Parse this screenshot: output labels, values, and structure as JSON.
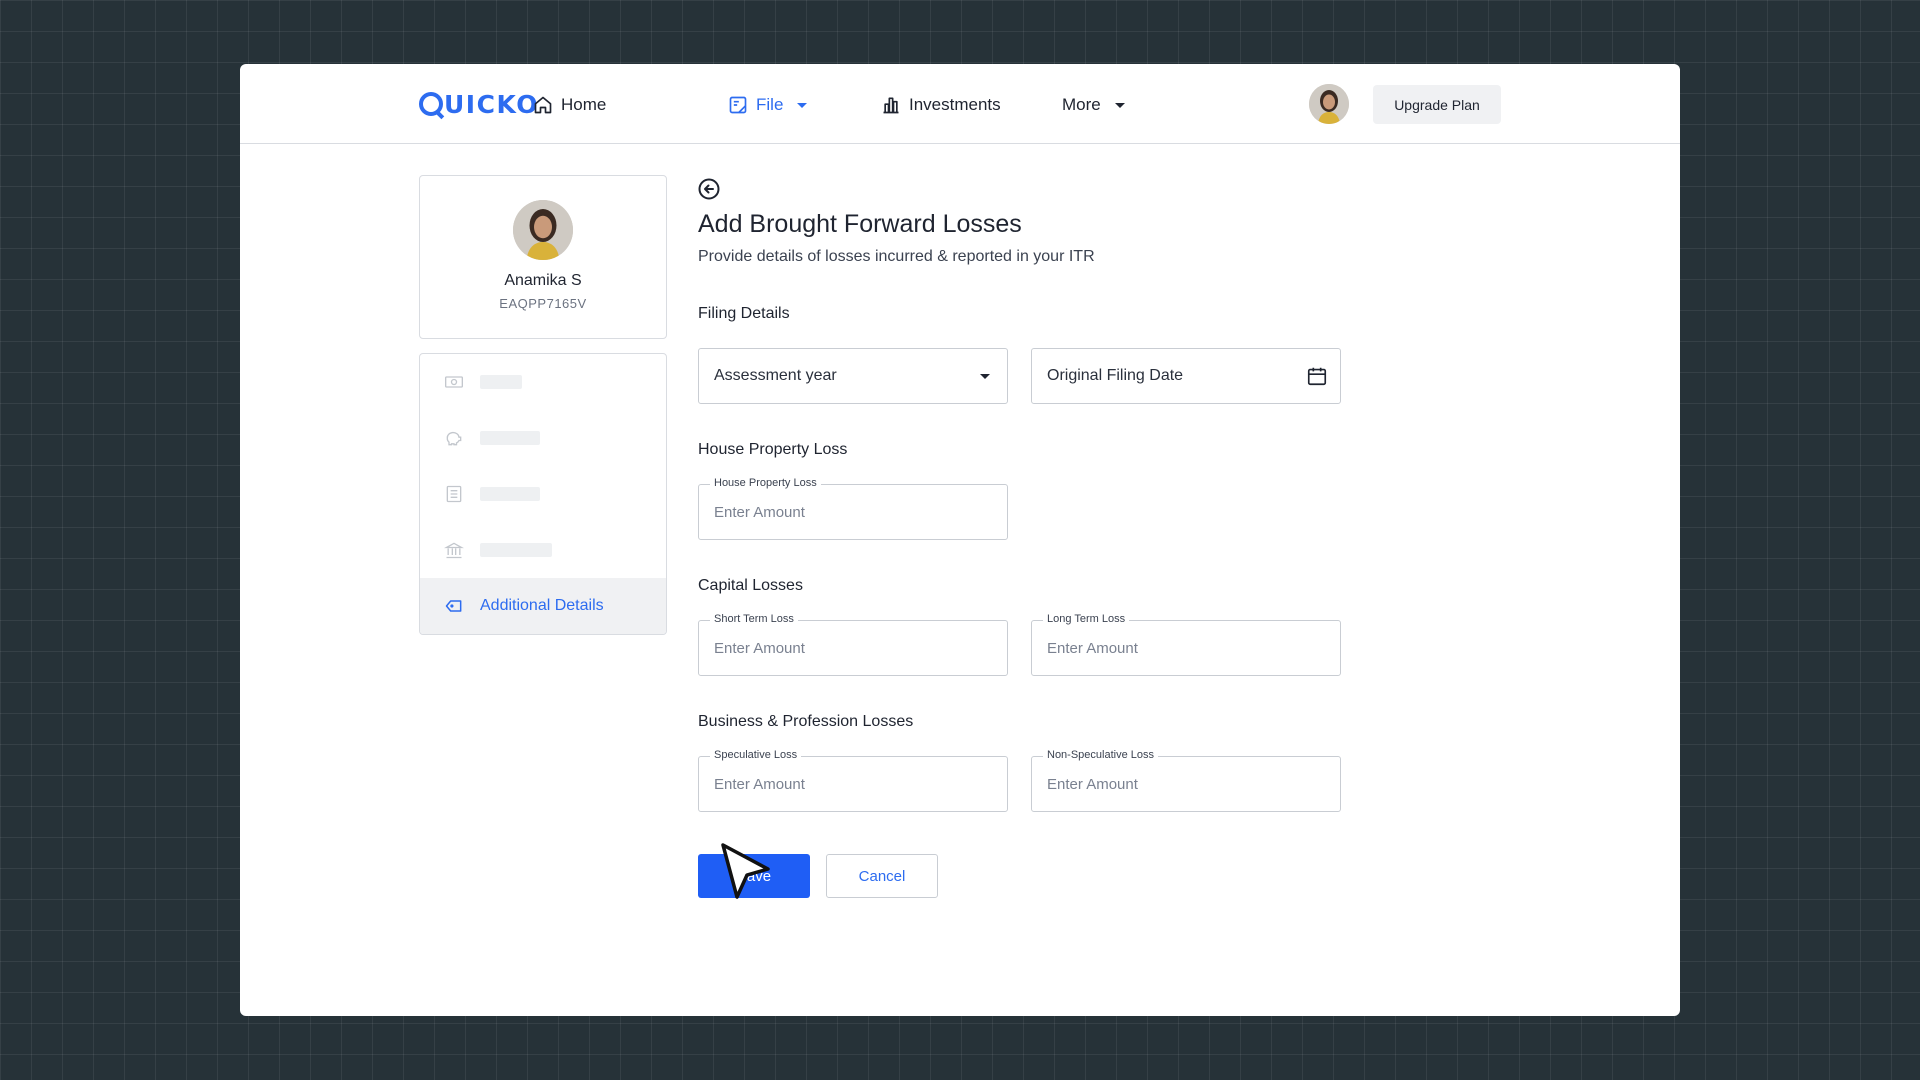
{
  "header": {
    "logo": "UICKO",
    "nav": [
      {
        "label": "Home"
      },
      {
        "label": "File"
      },
      {
        "label": "Investments"
      },
      {
        "label": "More"
      }
    ],
    "upgrade_label": "Upgrade Plan"
  },
  "profile": {
    "name": "Anamika S",
    "pan": "EAQPP7165V"
  },
  "sidebar": {
    "active_label": "Additional Details"
  },
  "main": {
    "title": "Add Brought Forward Losses",
    "subtitle": "Provide details of losses incurred & reported in your ITR",
    "filing": {
      "title": "Filing Details",
      "assessment_year": "Assessment year",
      "original_filing_date": "Original Filing Date"
    },
    "house": {
      "title": "House Property Loss",
      "field_label": "House Property Loss",
      "placeholder": "Enter Amount"
    },
    "capital": {
      "title": "Capital Losses",
      "short_label": "Short Term Loss",
      "long_label": "Long Term Loss",
      "placeholder": "Enter Amount"
    },
    "business": {
      "title": "Business & Profession Losses",
      "spec_label": "Speculative Loss",
      "nonspec_label": "Non-Speculative Loss",
      "placeholder": "Enter Amount"
    },
    "actions": {
      "save_label": "Save",
      "cancel_label": "Cancel"
    }
  },
  "colors": {
    "accent": "#2d6cf0",
    "primary_button": "#1f5ef5",
    "background": "#263238"
  }
}
